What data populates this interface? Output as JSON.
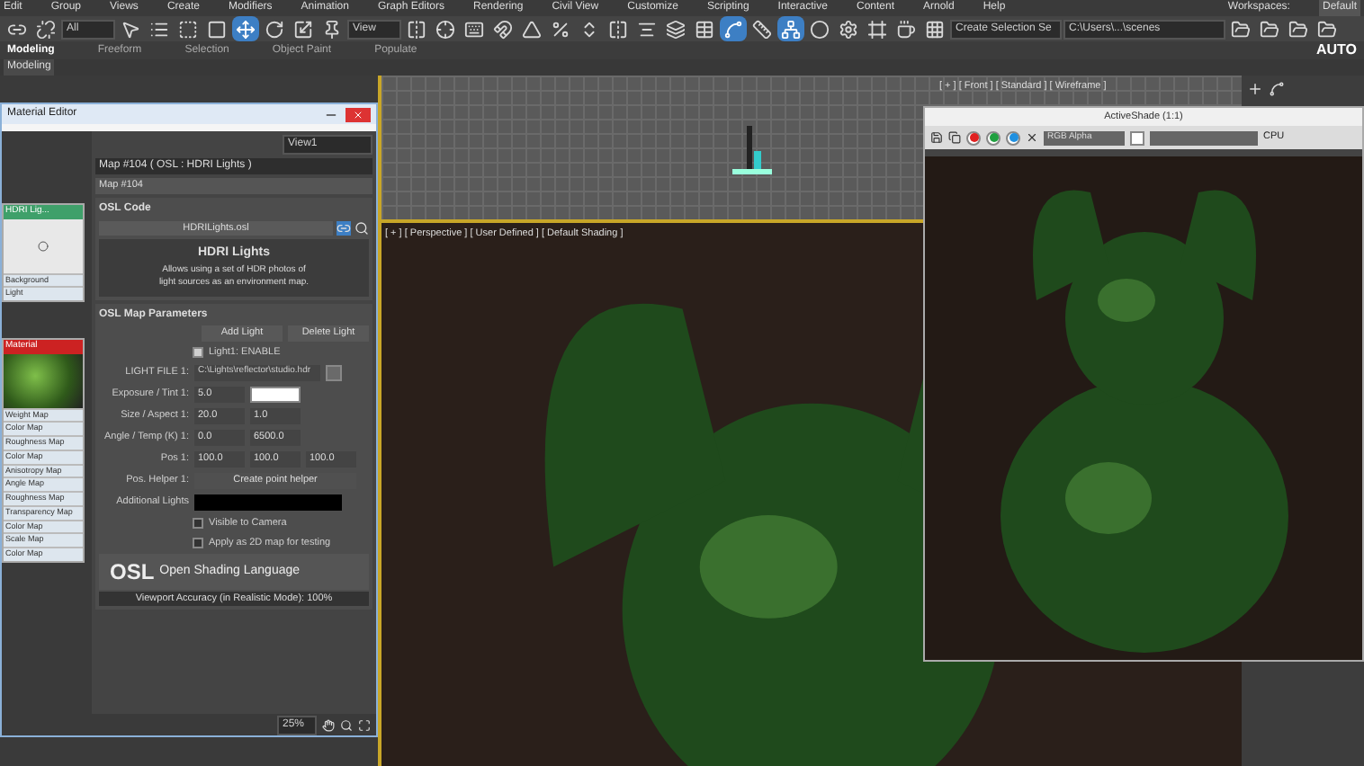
{
  "menu": [
    "Edit",
    "Group",
    "Views",
    "Create",
    "Modifiers",
    "Animation",
    "Graph Editors",
    "Rendering",
    "Civil View",
    "Customize",
    "Scripting",
    "Interactive",
    "Content",
    "Arnold",
    "Help"
  ],
  "workspaces": {
    "label": "Workspaces:",
    "value": "Default"
  },
  "toolbar": {
    "selection_filter": "All",
    "reference_coord": "View",
    "named_selection": "Create Selection Se",
    "project_path": "C:\\Users\\...\\scenes",
    "tools_left": [
      {
        "kind": "link",
        "selected": false
      },
      {
        "kind": "bind",
        "selected": false
      },
      {
        "kind": "select",
        "selected": false
      },
      {
        "kind": "list",
        "selected": false
      },
      {
        "kind": "region",
        "selected": false
      },
      {
        "kind": "window",
        "selected": false
      },
      {
        "kind": "move",
        "selected": true
      },
      {
        "kind": "rotate",
        "selected": false
      },
      {
        "kind": "scale",
        "selected": false
      },
      {
        "kind": "place",
        "selected": false
      }
    ],
    "tools_right": [
      {
        "kind": "pivot",
        "selected": false
      },
      {
        "kind": "crosshair",
        "selected": false
      },
      {
        "kind": "keyboard",
        "selected": false
      },
      {
        "kind": "snap",
        "selected": false
      },
      {
        "kind": "angle",
        "selected": false
      },
      {
        "kind": "percent",
        "selected": false
      },
      {
        "kind": "spinner",
        "selected": false
      },
      {
        "kind": "mirror",
        "selected": false
      },
      {
        "kind": "align",
        "selected": false
      },
      {
        "kind": "layers",
        "selected": false
      },
      {
        "kind": "table",
        "selected": false
      },
      {
        "kind": "curve",
        "selected": true
      },
      {
        "kind": "ruler",
        "selected": false
      },
      {
        "kind": "schematic",
        "selected": true
      },
      {
        "kind": "material",
        "selected": false
      },
      {
        "kind": "render-setup",
        "selected": false
      },
      {
        "kind": "frame",
        "selected": false
      },
      {
        "kind": "teapot",
        "selected": false
      },
      {
        "kind": "grid",
        "selected": false
      }
    ],
    "tools_far": [
      {
        "kind": "folder",
        "selected": false
      },
      {
        "kind": "folder",
        "selected": false
      },
      {
        "kind": "folder",
        "selected": false
      },
      {
        "kind": "folder",
        "selected": false
      }
    ]
  },
  "ribbon": {
    "tabs": [
      {
        "label": "Modeling",
        "selected": true
      },
      {
        "label": "Freeform",
        "selected": false
      },
      {
        "label": "Selection",
        "selected": false
      },
      {
        "label": "Object Paint",
        "selected": false
      },
      {
        "label": "Populate",
        "selected": false
      }
    ],
    "panel": "Modeling",
    "logo": "AUTO"
  },
  "viewports": [
    {
      "label": "[ + ] [ Front ] [ Standard ] [ Wireframe ]",
      "kind": "grid"
    },
    {
      "label": "[ + ] [ Perspective ] [ User Defined ] [ Default Shading ]",
      "kind": "render"
    }
  ],
  "material_editor": {
    "title": "Material Editor",
    "view": "View1",
    "map_name": "Map #104 ( OSL : HDRI Lights )",
    "map_field": "Map #104",
    "nodes": [
      {
        "title": "HDRI Lig...",
        "color": "#3fa06a",
        "outputs": [
          "Background",
          "Light"
        ],
        "kind": "map"
      },
      {
        "title": "Material",
        "color": "#cc2222",
        "outputs": [
          "Weight Map",
          "Color Map",
          "Roughness Map",
          "Color Map",
          "Anisotropy Map",
          "Angle Map",
          "Roughness Map",
          "Transparency Map",
          "Color Map",
          "Scale Map",
          "Color Map"
        ],
        "kind": "material"
      }
    ],
    "osl_code": {
      "heading": "OSL Code",
      "file": "HDRILights.osl",
      "title": "HDRI Lights",
      "description": "Allows using a set of HDR photos of light sources as an environment map."
    },
    "params": {
      "heading": "OSL Map Parameters",
      "buttons": [
        "Add Light",
        "Delete Light"
      ],
      "rows": [
        {
          "kind": "check",
          "label": "Light1: ENABLE",
          "checked": true
        },
        {
          "kind": "file",
          "label": "LIGHT FILE 1:",
          "value": "C:\\Lights\\reflector\\studio.hdr"
        },
        {
          "kind": "spinners",
          "label": "Exposure / Tint 1:",
          "values": [
            "5.0"
          ],
          "color": "#ffffff"
        },
        {
          "kind": "spinners",
          "label": "Size / Aspect 1:",
          "values": [
            "20.0",
            "1.0"
          ]
        },
        {
          "kind": "spinners",
          "label": "Angle / Temp (K) 1:",
          "values": [
            "0.0",
            "6500.0"
          ]
        },
        {
          "kind": "spinners",
          "label": "Pos 1:",
          "values": [
            "100.0",
            "100.0",
            "100.0"
          ]
        },
        {
          "kind": "button",
          "label": "Pos. Helper 1:",
          "value": "Create point helper"
        },
        {
          "kind": "swatch",
          "label": "Additional Lights",
          "color": "#000000"
        },
        {
          "kind": "check",
          "label": "Visible to Camera",
          "checked": false
        },
        {
          "kind": "check",
          "label": "Apply as 2D map for testing",
          "checked": false
        }
      ],
      "logo_mark": "OSL",
      "logo_text": "Open Shading Language",
      "accuracy": "Viewport Accuracy (in Realistic Mode): 100%"
    },
    "zoom": "25%"
  },
  "active_shade": {
    "title": "ActiveShade (1:1)",
    "channels": [
      {
        "color": "#e02020",
        "selected": true
      },
      {
        "color": "#20a040",
        "selected": true
      },
      {
        "color": "#2090e0",
        "selected": true
      }
    ],
    "display": "RGB Alpha",
    "engine": "CPU"
  }
}
